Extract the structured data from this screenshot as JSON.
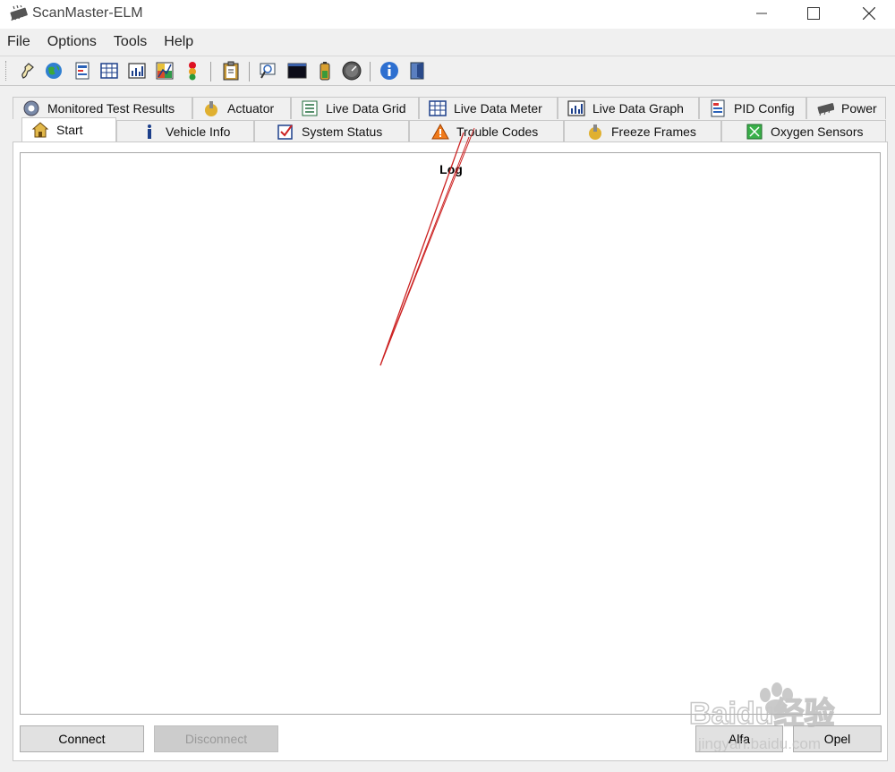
{
  "window": {
    "title": "ScanMaster-ELM",
    "controls": [
      "minimize-icon",
      "maximize-icon",
      "close-icon"
    ]
  },
  "menu": {
    "items": [
      "File",
      "Options",
      "Tools",
      "Help"
    ]
  },
  "toolbar": {
    "icons": [
      "connect-plug-icon",
      "globe-icon",
      "report-icon",
      "data-grid-icon",
      "graph-icon",
      "chart-icon",
      "traffic-light-icon",
      "clipboard-icon",
      "search-log-icon",
      "terminal-icon",
      "battery-icon",
      "gauge-icon",
      "info-icon",
      "exit-icon"
    ]
  },
  "tabs": {
    "row1": [
      {
        "label": "Monitored Test Results",
        "icon": "gear-icon"
      },
      {
        "label": "Actuator",
        "icon": "actuator-icon"
      },
      {
        "label": "Live Data Grid",
        "icon": "list-icon"
      },
      {
        "label": "Live Data Meter",
        "icon": "grid-icon"
      },
      {
        "label": "Live Data Graph",
        "icon": "bar-chart-icon"
      },
      {
        "label": "PID Config",
        "icon": "config-icon"
      },
      {
        "label": "Power",
        "icon": "power-icon"
      }
    ],
    "row2": [
      {
        "label": "Start",
        "icon": "home-icon"
      },
      {
        "label": "Vehicle Info",
        "icon": "info-icon"
      },
      {
        "label": "System Status",
        "icon": "checkbox-icon"
      },
      {
        "label": "Trouble Codes",
        "icon": "warning-icon"
      },
      {
        "label": "Freeze Frames",
        "icon": "freeze-icon"
      },
      {
        "label": "Oxygen Sensors",
        "icon": "sensor-icon"
      }
    ],
    "active": "Start"
  },
  "log": {
    "title": "Log"
  },
  "buttons": {
    "connect": "Connect",
    "disconnect": "Disconnect",
    "alfa": "Alfa",
    "opel": "Opel"
  },
  "watermark": {
    "text": "Baidu经验",
    "url": "jingyan.baidu.com"
  },
  "colors": {
    "annotation_line": "#cc2222",
    "active_tab": "#ffffff",
    "window_bg": "#f0f0f0"
  }
}
